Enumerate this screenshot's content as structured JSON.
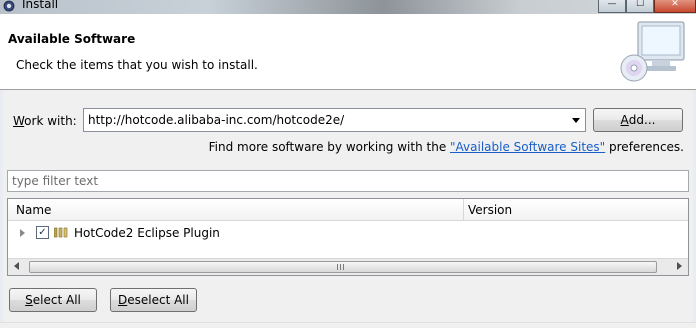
{
  "window": {
    "title": "Install",
    "minimize_glyph": "—",
    "maximize_glyph": "☐",
    "close_glyph": "✕"
  },
  "header": {
    "title": "Available Software",
    "description": "Check the items that you wish to install."
  },
  "work_with": {
    "label_accelerator": "W",
    "label_rest": "ork with:",
    "value": "http://hotcode.alibaba-inc.com/hotcode2e/"
  },
  "add_button": {
    "accelerator": "A",
    "rest": "dd..."
  },
  "find_more": {
    "prefix": "Find more software by working with the ",
    "link": "\"Available Software Sites\"",
    "suffix": " preferences."
  },
  "filter": {
    "placeholder": "type filter text"
  },
  "tree": {
    "columns": {
      "name": "Name",
      "version": "Version"
    },
    "items": [
      {
        "label": "HotCode2 Eclipse Plugin",
        "version": "",
        "checked": true
      }
    ],
    "scroll_grip": "III"
  },
  "buttons": {
    "select_all_accelerator": "S",
    "select_all_rest": "elect All",
    "deselect_all_accelerator": "D",
    "deselect_all_rest": "eselect All"
  },
  "icons": {
    "app": "eclipse-gear-icon",
    "wizard": "install-computer-cd-icon",
    "feature": "feature-package-icon",
    "checkmark": "✓"
  },
  "colors": {
    "link": "#1a5ec8",
    "close_button": "#c9492e"
  }
}
